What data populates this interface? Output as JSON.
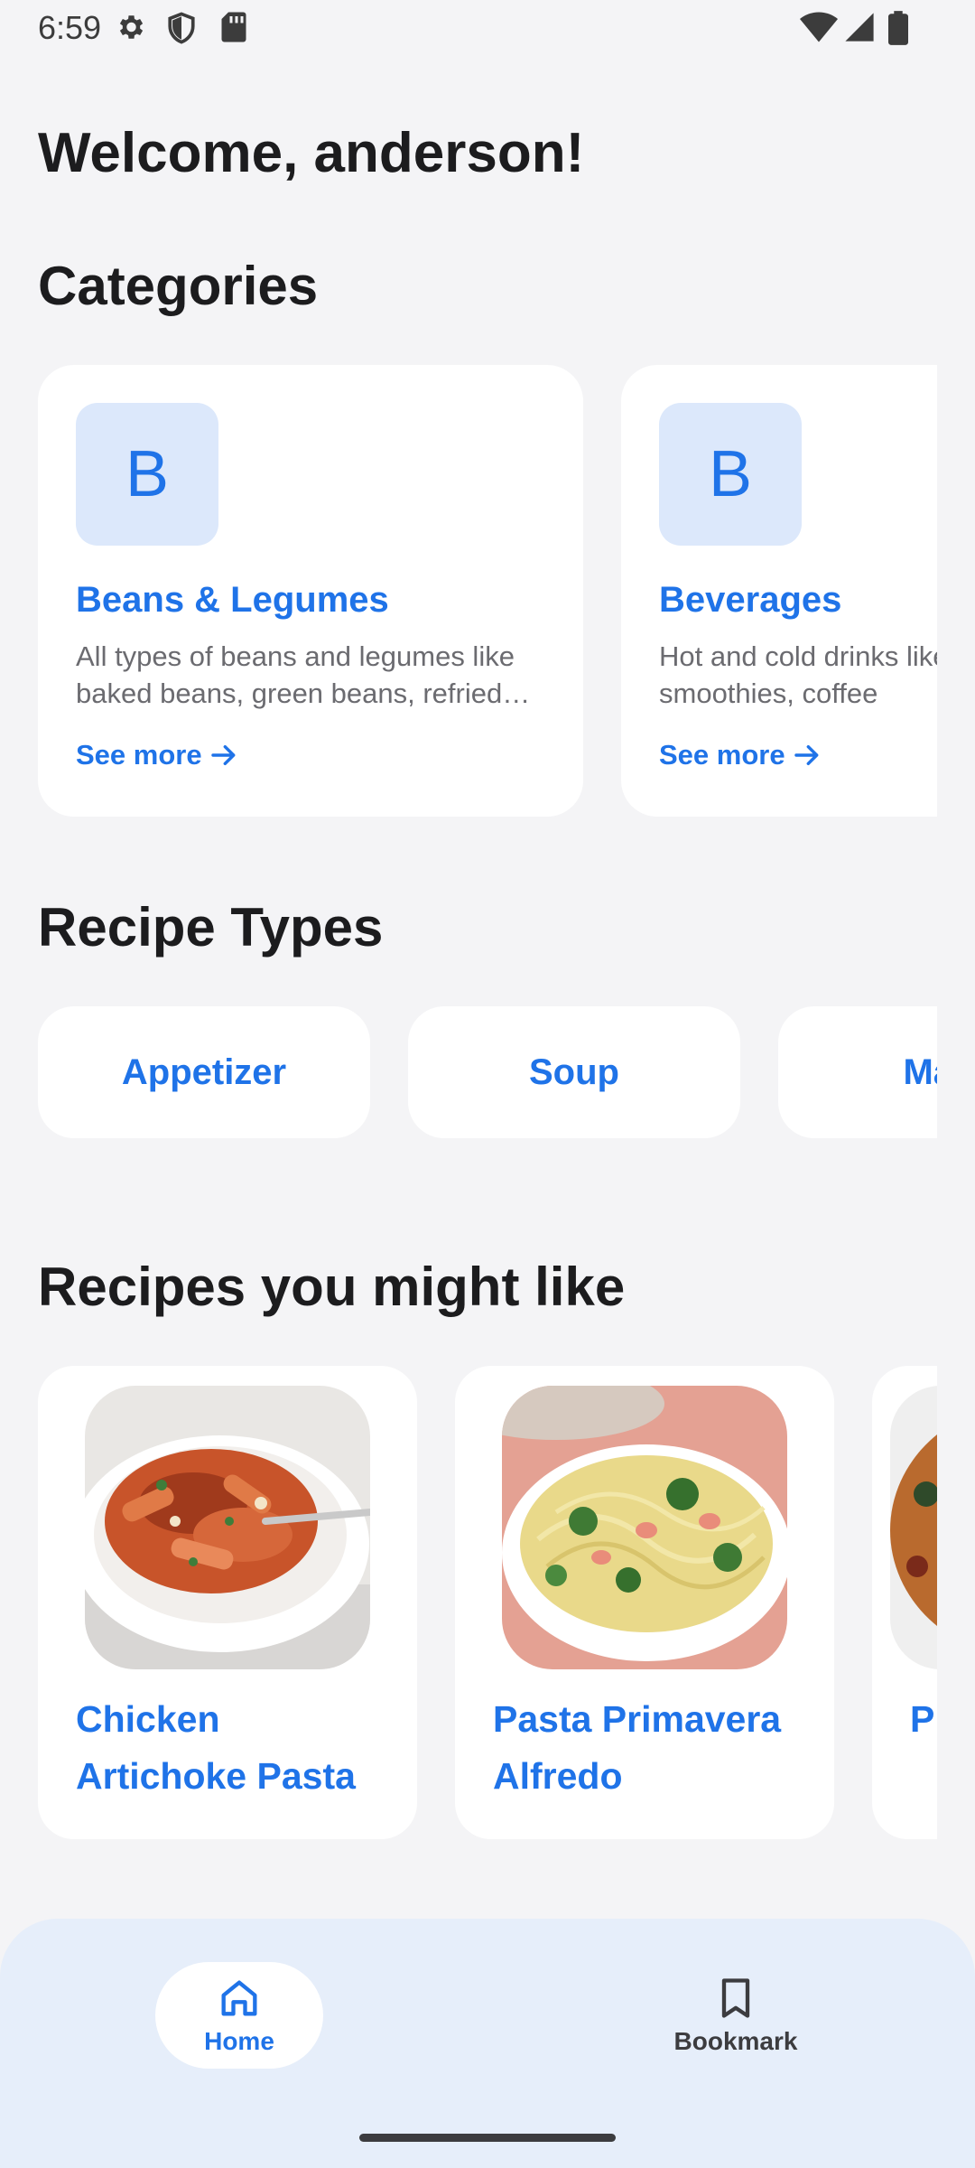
{
  "status_bar": {
    "time": "6:59"
  },
  "welcome": "Welcome, anderson!",
  "sections": {
    "categories": "Categories",
    "recipe_types": "Recipe Types",
    "recipes": "Recipes you might like"
  },
  "categories": [
    {
      "initial": "B",
      "name": "Beans & Legumes",
      "description": "All types of beans and legumes like baked beans, green beans, refried beans",
      "see_more": "See more"
    },
    {
      "initial": "B",
      "name": "Beverages",
      "description": "Hot and cold drinks like soda, smoothies, coffee",
      "see_more": "See more"
    }
  ],
  "recipe_types": [
    "Appetizer",
    "Soup",
    "Main"
  ],
  "recipes": [
    {
      "title": "Chicken Artichoke Pasta"
    },
    {
      "title": "Pasta Primavera Alfredo"
    },
    {
      "title": "P"
    }
  ],
  "nav": {
    "home": "Home",
    "bookmark": "Bookmark"
  },
  "colors": {
    "accent": "#1f73e8",
    "background": "#f4f4f6",
    "nav_background": "#e6eefa",
    "chip_background": "#dce8fb"
  }
}
